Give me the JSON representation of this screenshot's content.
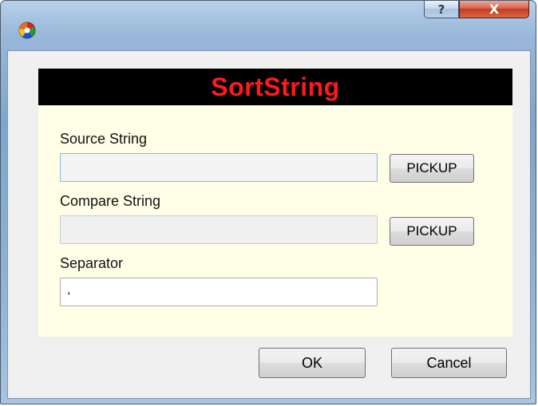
{
  "window": {
    "help_glyph": "?",
    "close_glyph": "X",
    "app_icon": "colorful-circle-icon"
  },
  "banner": {
    "title": "SortString",
    "title_color": "#ff1a1a",
    "background": "#000000"
  },
  "form": {
    "source": {
      "label": "Source String",
      "value": "",
      "button_label": "PICKUP"
    },
    "compare": {
      "label": "Compare String",
      "value": "",
      "button_label": "PICKUP"
    },
    "separator": {
      "label": "Separator",
      "value": ","
    }
  },
  "footer": {
    "ok_label": "OK",
    "cancel_label": "Cancel"
  },
  "colors": {
    "panel_background": "#ffffe8",
    "client_background": "#f0f0f0"
  }
}
